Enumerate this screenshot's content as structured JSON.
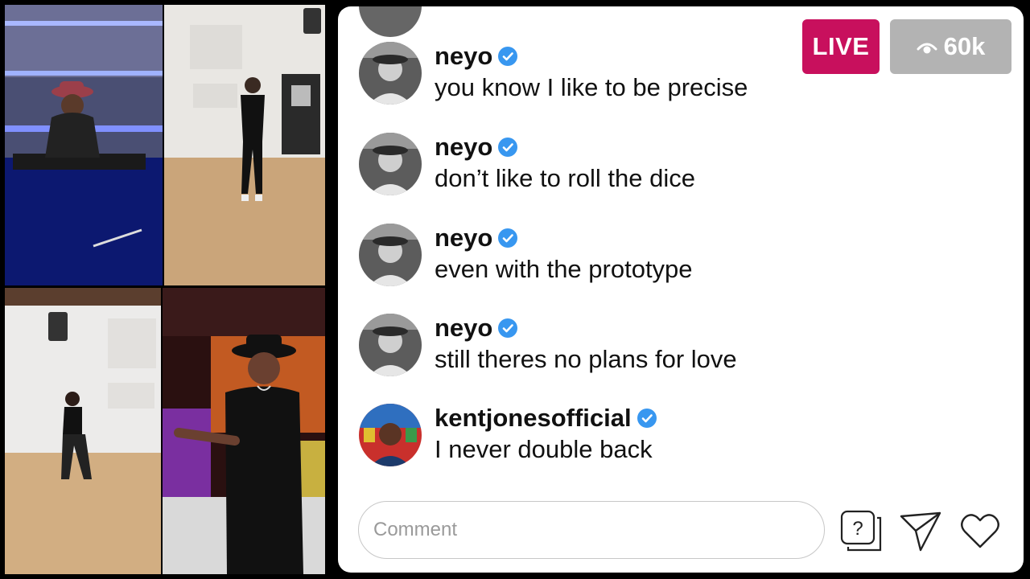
{
  "stream": {
    "live_label": "LIVE",
    "viewer_count": "60k",
    "viewer_icon": "eye-icon"
  },
  "video_tiles": [
    {
      "name": "dj-tile",
      "scene": "dj booth with purple lights"
    },
    {
      "name": "dancer-tile",
      "scene": "dancer in studio"
    },
    {
      "name": "dancer2-tile",
      "scene": "dancer in white room"
    },
    {
      "name": "singer-tile",
      "scene": "singer in recording studio"
    }
  ],
  "comments": [
    {
      "user": "neyo",
      "verified": true,
      "text": "you know I like to be precise"
    },
    {
      "user": "neyo",
      "verified": true,
      "text": "don’t like to roll the dice"
    },
    {
      "user": "neyo",
      "verified": true,
      "text": "even with the prototype"
    },
    {
      "user": "neyo",
      "verified": true,
      "text": "still theres no plans for love"
    },
    {
      "user": "kentjonesofficial",
      "verified": true,
      "text": "I never double back"
    }
  ],
  "comment_bar": {
    "placeholder": "Comment",
    "icons": [
      "question-icon",
      "send-icon",
      "heart-icon"
    ]
  },
  "colors": {
    "live": "#c8105d",
    "viewer_bg": "#b3b3b3",
    "verified": "#3897f0"
  }
}
